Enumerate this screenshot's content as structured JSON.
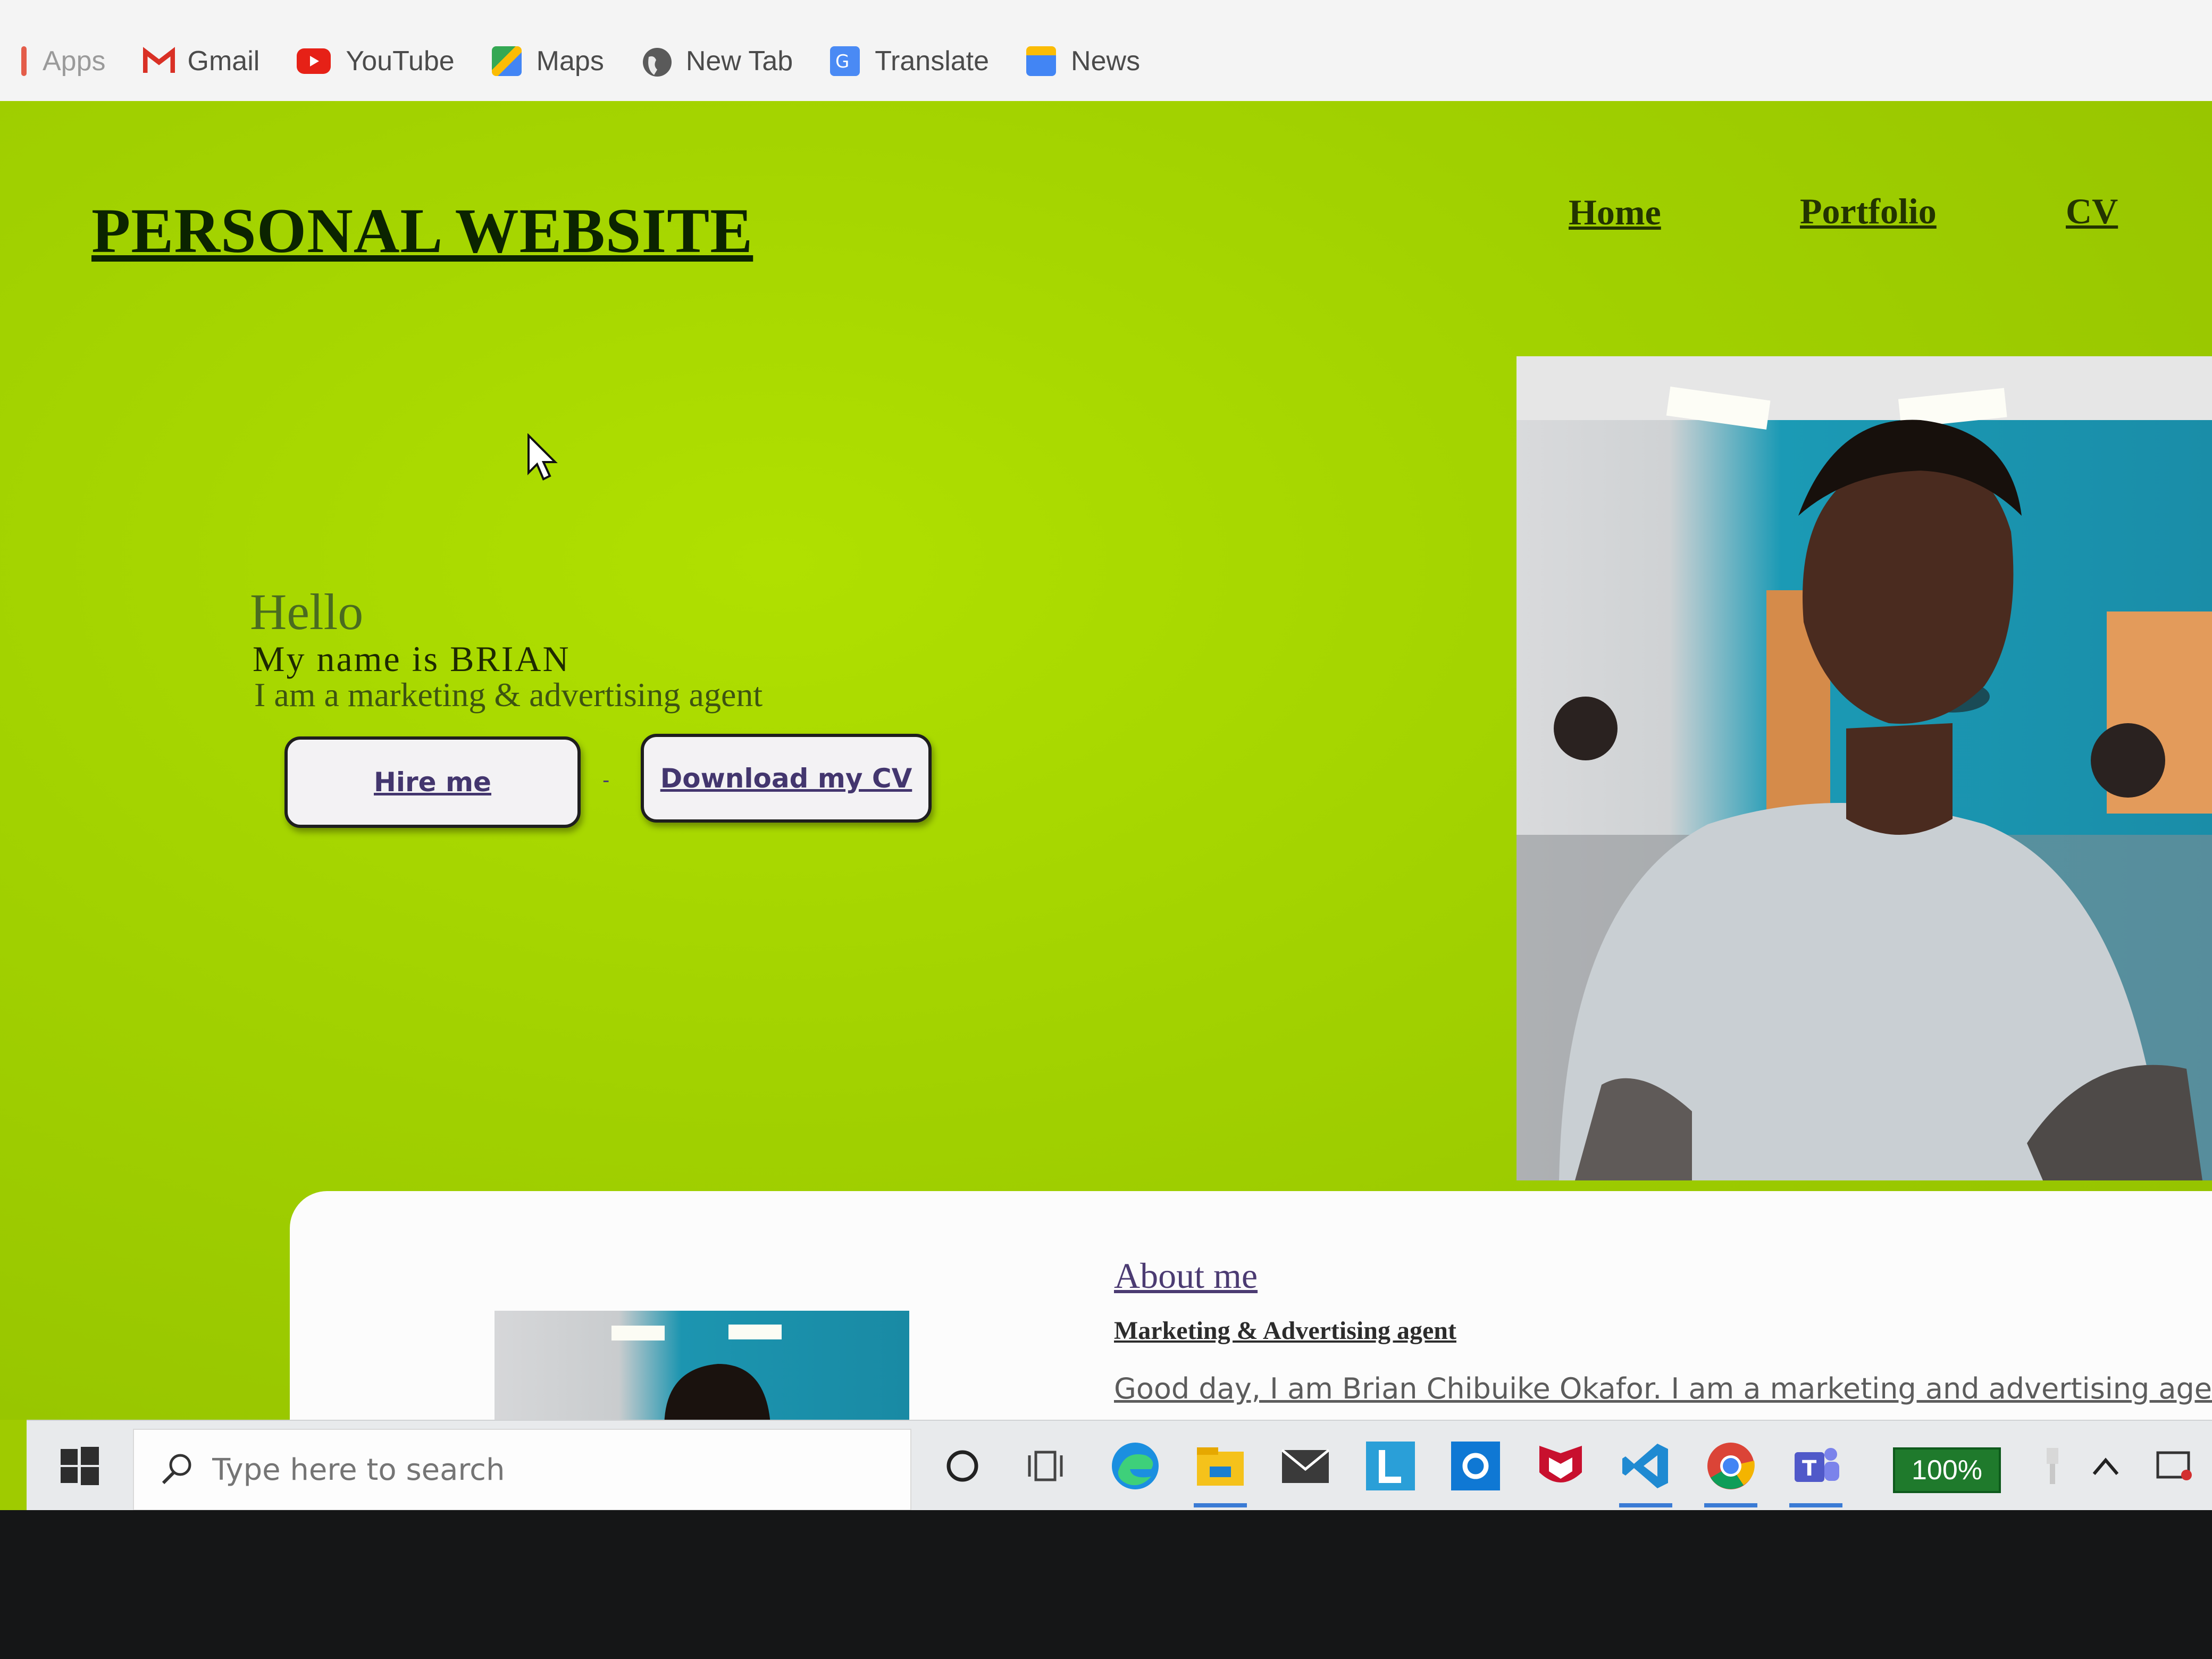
{
  "bookmarks": [
    {
      "label": "Apps",
      "icon": "apps-grid-icon"
    },
    {
      "label": "Gmail",
      "icon": "gmail-icon"
    },
    {
      "label": "YouTube",
      "icon": "youtube-icon"
    },
    {
      "label": "Maps",
      "icon": "maps-icon"
    },
    {
      "label": "New Tab",
      "icon": "globe-icon"
    },
    {
      "label": "Translate",
      "icon": "translate-icon"
    },
    {
      "label": "News",
      "icon": "news-icon"
    }
  ],
  "site": {
    "title": "PERSONAL WEBSITE",
    "nav": [
      "Home",
      "Portfolio",
      "CV"
    ],
    "background": "#a3d100"
  },
  "hero": {
    "greeting": "Hello",
    "name_line": "My name is BRIAN",
    "role_line": "I am a marketing & advertising agent",
    "hire_button": "Hire me",
    "separator": "-",
    "cv_button": "Download my CV"
  },
  "about": {
    "heading": "About me",
    "subheading": "Marketing & Advertising agent",
    "text": "Good day, I am Brian Chibuike Okafor. I am a marketing and advertising agent."
  },
  "taskbar": {
    "search_placeholder": "Type here to search",
    "battery": "100%",
    "apps": [
      "cortana-icon",
      "task-view-icon",
      "edge-icon",
      "file-explorer-icon",
      "mail-icon",
      "l-app-icon",
      "outlook-icon",
      "mcafee-icon",
      "vscode-icon",
      "chrome-icon",
      "teams-icon"
    ]
  }
}
